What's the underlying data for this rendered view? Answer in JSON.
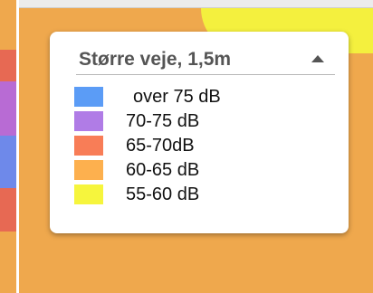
{
  "legend": {
    "title": "Større veje, 1,5m",
    "items": [
      {
        "label": "over 75 dB",
        "color": "#5b9cf6"
      },
      {
        "label": "70-75 dB",
        "color": "#b07ce6"
      },
      {
        "label": "65-70dB",
        "color": "#f87d57"
      },
      {
        "label": "60-65 dB",
        "color": "#fdb04e"
      },
      {
        "label": "55-60 dB",
        "color": "#f6f53d"
      }
    ]
  },
  "map": {
    "base_color": "#efa84d",
    "left_strip_colors": [
      "#e76953",
      "#b86bd4",
      "#6e89ea"
    ]
  }
}
